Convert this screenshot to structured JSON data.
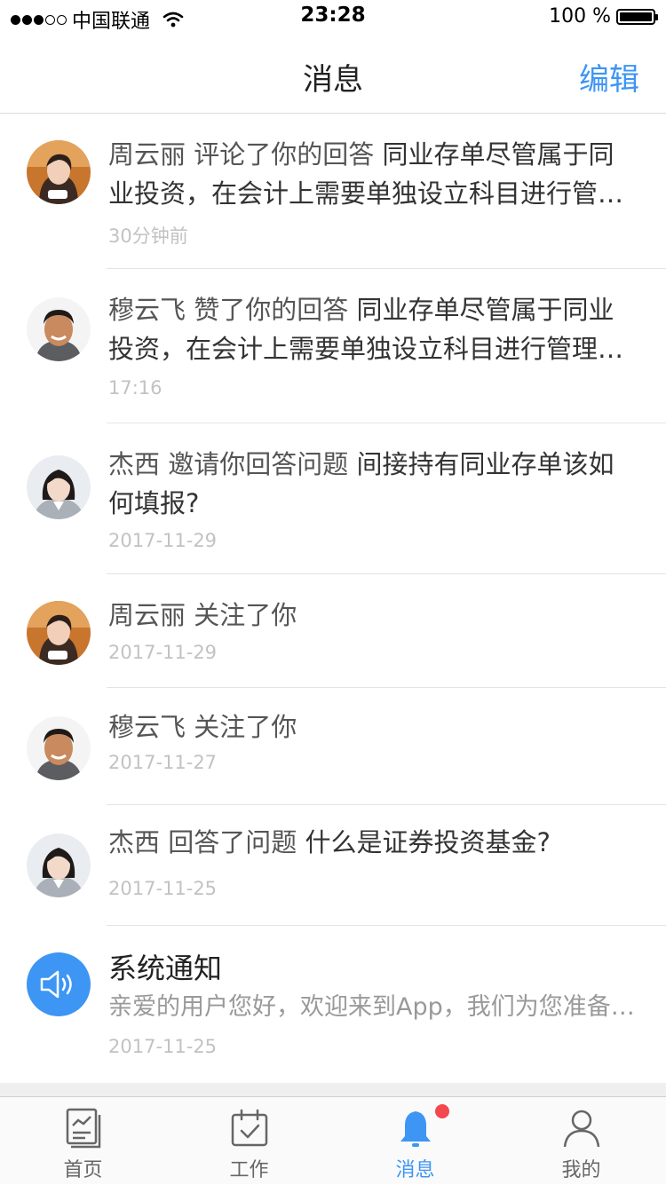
{
  "status_bar": {
    "carrier": "中国联通",
    "time": "23:28",
    "battery": "100 %"
  },
  "header": {
    "title": "消息",
    "edit_label": "编辑"
  },
  "messages": [
    {
      "actor": "周云丽",
      "action": "评论了你的回答",
      "line1_rest": "同业存单尽管属于同",
      "line2": "业投资，在会计上需要单独设立科目进行管…",
      "time": "30分钟前",
      "avatar": "woman-warm-avatar"
    },
    {
      "actor": "穆云飞",
      "action": "赞了你的回答",
      "line1_rest": "同业存单尽管属于同业",
      "line2": "投资，在会计上需要单独设立科目进行管理…",
      "time": "17:16",
      "avatar": "man-avatar"
    },
    {
      "actor": "杰西",
      "action": "邀请你回答问题",
      "line1_rest": "间接持有同业存单该如",
      "line2": "何填报?",
      "time": "2017-11-29",
      "avatar": "woman-suit-avatar"
    },
    {
      "actor": "周云丽",
      "action": "关注了你",
      "line1_rest": "",
      "line2": "",
      "time": "2017-11-29",
      "avatar": "woman-warm-avatar"
    },
    {
      "actor": "穆云飞",
      "action": "关注了你",
      "line1_rest": "",
      "line2": "",
      "time": "2017-11-27",
      "avatar": "man-avatar"
    },
    {
      "actor": "杰西",
      "action": "回答了问题",
      "line1_rest": "什么是证券投资基金?",
      "line2": "",
      "time": "2017-11-25",
      "avatar": "woman-suit-avatar"
    }
  ],
  "system_notice": {
    "title": "系统通知",
    "preview": "亲爱的用户您好，欢迎来到App，我们为您准备…",
    "time": "2017-11-25",
    "icon": "speaker-icon"
  },
  "tabs": [
    {
      "label": "首页",
      "icon": "home-doc-icon"
    },
    {
      "label": "工作",
      "icon": "calendar-check-icon"
    },
    {
      "label": "消息",
      "icon": "bell-icon",
      "active": true,
      "badge": true
    },
    {
      "label": "我的",
      "icon": "person-icon"
    }
  ],
  "colors": {
    "accent": "#3d95f4",
    "badge": "#f3484f",
    "time_text": "#c2c2c2"
  }
}
